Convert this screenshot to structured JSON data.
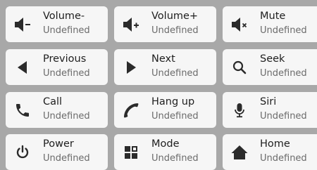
{
  "buttons": [
    {
      "label": "Volume-",
      "value": "Undefined",
      "icon": "volume-down-icon"
    },
    {
      "label": "Volume+",
      "value": "Undefined",
      "icon": "volume-up-icon"
    },
    {
      "label": "Mute",
      "value": "Undefined",
      "icon": "mute-icon"
    },
    {
      "label": "Previous",
      "value": "Undefined",
      "icon": "previous-icon"
    },
    {
      "label": "Next",
      "value": "Undefined",
      "icon": "next-icon"
    },
    {
      "label": "Seek",
      "value": "Undefined",
      "icon": "search-icon"
    },
    {
      "label": "Call",
      "value": "Undefined",
      "icon": "phone-icon"
    },
    {
      "label": "Hang up",
      "value": "Undefined",
      "icon": "hang-up-icon"
    },
    {
      "label": "Siri",
      "value": "Undefined",
      "icon": "microphone-icon"
    },
    {
      "label": "Power",
      "value": "Undefined",
      "icon": "power-icon"
    },
    {
      "label": "Mode",
      "value": "Undefined",
      "icon": "mode-grid-icon"
    },
    {
      "label": "Home",
      "value": "Undefined",
      "icon": "home-icon"
    }
  ],
  "colors": {
    "background": "#a8a8a8",
    "tile": "#f6f6f6",
    "icon": "#2b2b2b",
    "value_text": "#6b6b6b"
  }
}
